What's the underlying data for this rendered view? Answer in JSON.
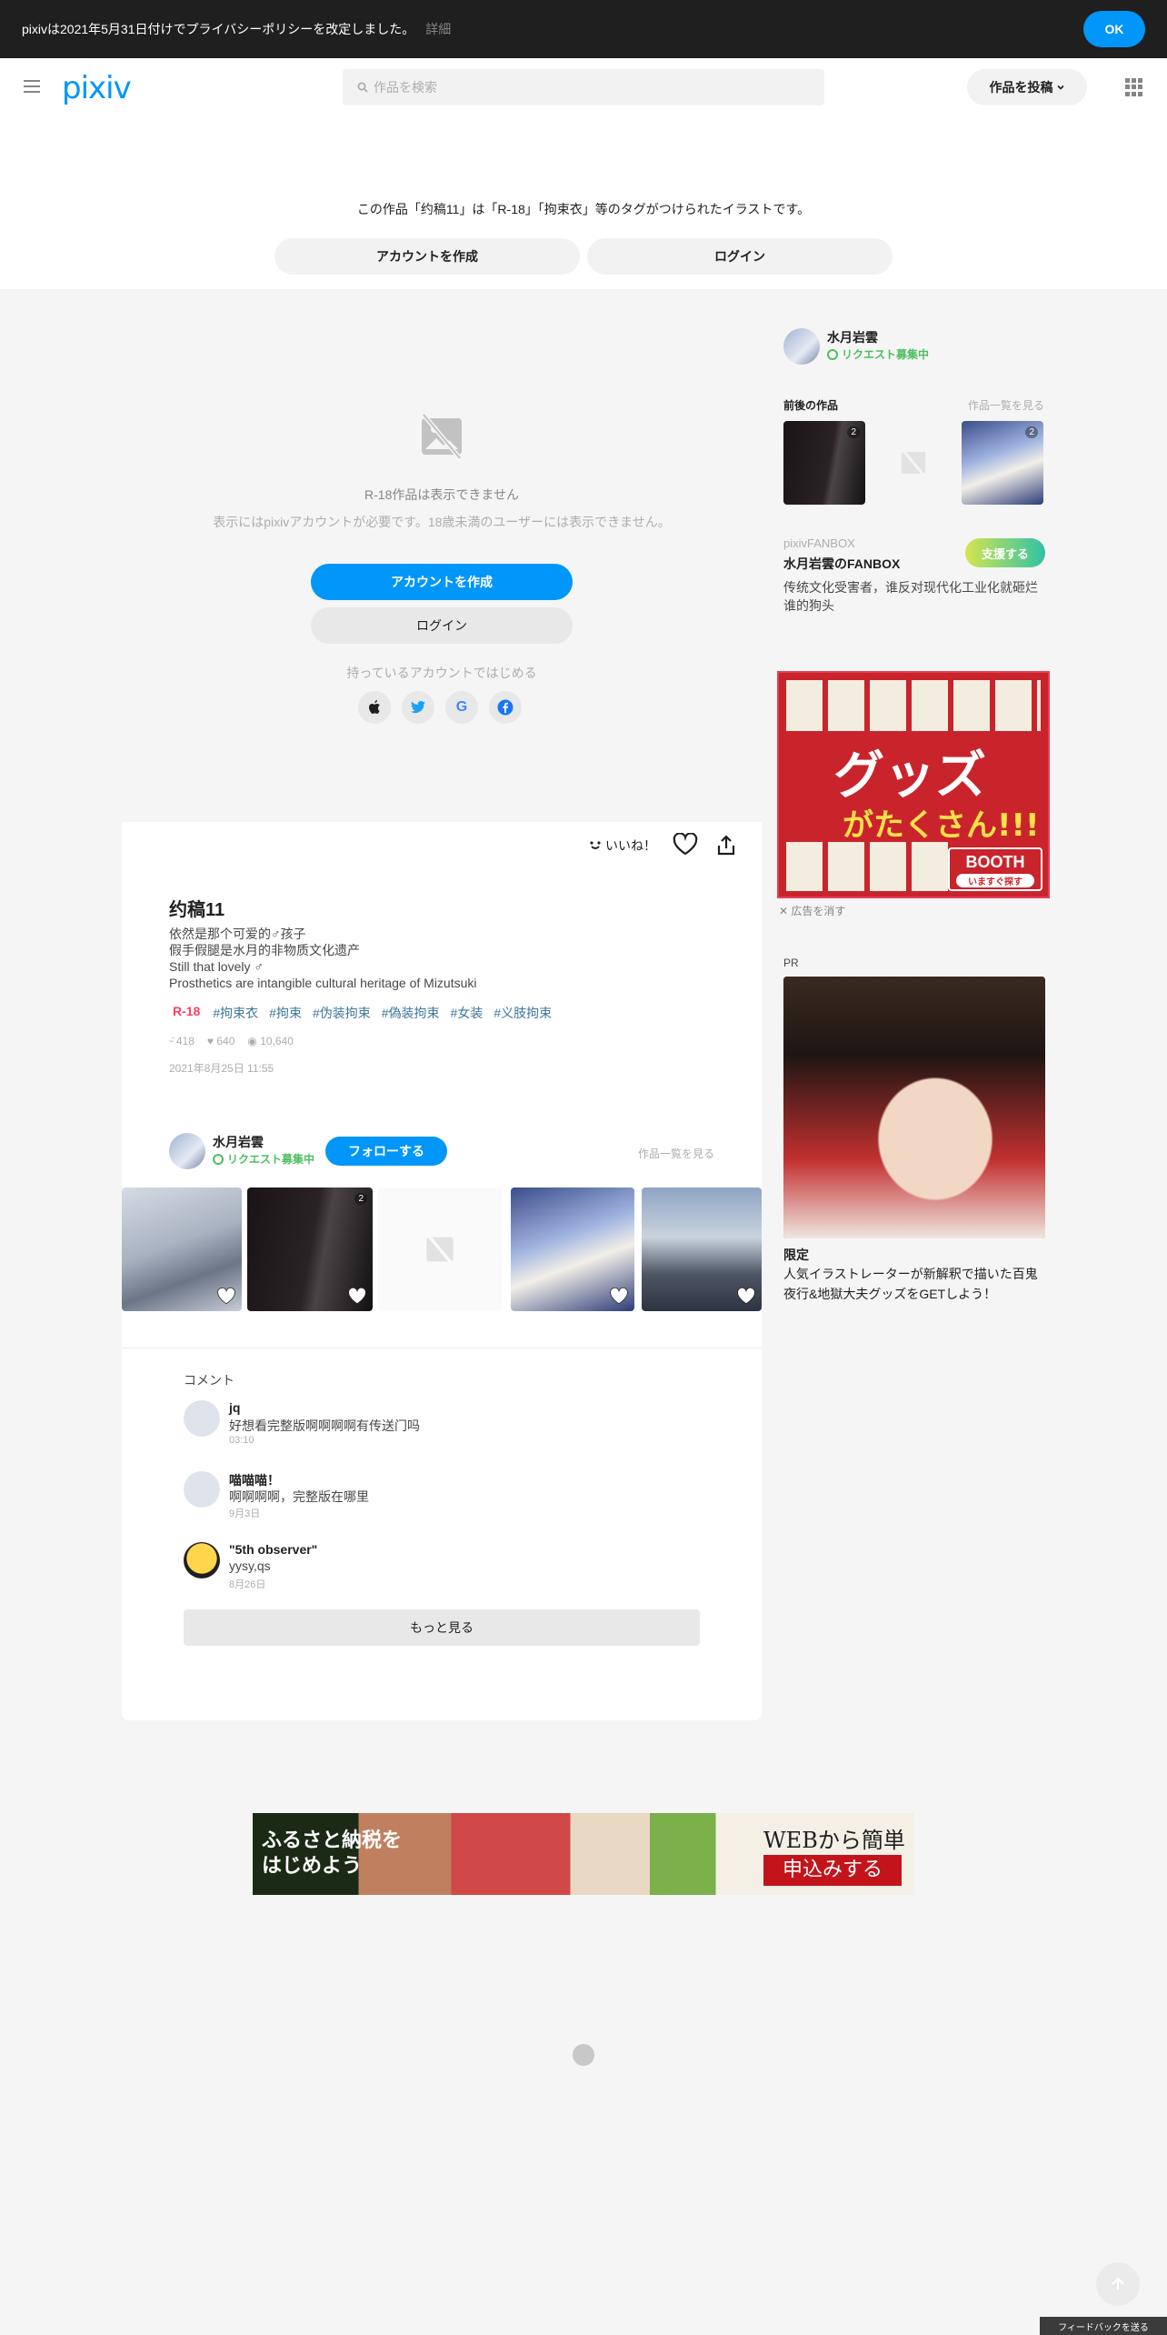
{
  "notice": {
    "text": "pixivは2021年5月31日付けでプライバシーポリシーを改定しました。",
    "detail": "詳細",
    "ok": "OK"
  },
  "header": {
    "logo": "pixiv",
    "search_placeholder": "作品を検索",
    "post_label": "作品を投稿"
  },
  "top": {
    "tagline": "この作品「约稿11」は「R-18」「拘束衣」等のタグがつけられたイラストです。",
    "create_account": "アカウントを作成",
    "login": "ログイン"
  },
  "restricted": {
    "title": "R-18作品は表示できません",
    "subtitle": "表示にはpixivアカウントが必要です。18歳未満のユーザーには表示できません。",
    "create_account": "アカウントを作成",
    "login": "ログイン",
    "existing": "持っているアカウントではじめる",
    "social": [
      "apple-icon",
      "twitter-icon",
      "google-icon",
      "facebook-icon"
    ]
  },
  "artwork": {
    "iine": "いいね！",
    "title": "约稿11",
    "description": [
      "依然是那个可爱的♂孩子",
      "假手假腿是水月的非物质文化遗产",
      "Still that lovely ♂",
      "Prosthetics are intangible cultural heritage of Mizutsuki"
    ],
    "r18": "R-18",
    "tags": [
      "#拘束衣",
      "#拘束",
      "#伪装拘束",
      "#偽装拘束",
      "#女装",
      "#义肢拘束"
    ],
    "likes": "418",
    "bookmarks": "640",
    "views": "10,640",
    "date": "2021年8月25日 11:55"
  },
  "author": {
    "name": "水月岩雲",
    "request": "リクエスト募集中",
    "follow": "フォローする",
    "work_list": "作品一覧を見る",
    "badge_count": "2"
  },
  "comments": {
    "heading": "コメント",
    "items": [
      {
        "name": "jq",
        "text": "好想看完整版啊啊啊啊有传送门吗",
        "time": "03:10"
      },
      {
        "name": "喵喵喵！",
        "text": "啊啊啊啊，完整版在哪里",
        "time": "9月3日"
      },
      {
        "name": "\"5th observer\"",
        "text": "yysy,qs",
        "time": "8月26日"
      }
    ],
    "more": "もっと見る"
  },
  "sidebar": {
    "name": "水月岩雲",
    "request": "リクエスト募集中",
    "adjacent": "前後の作品",
    "work_list": "作品一覧を見る",
    "thumb_badge": "2",
    "fanbox_label": "pixivFANBOX",
    "fanbox_title": "水月岩雲のFANBOX",
    "fanbox_desc": "传统文化受害者，谁反对现代化工业化就砸烂谁的狗头",
    "support": "支援する",
    "hide_ad": "広告を消す",
    "pr": "PR",
    "pr_title": "限定",
    "pr_desc": "人気イラストレーターが新解釈で描いた百鬼夜行&地獄大夫グッズをGETしよう！"
  },
  "booth_ad": {
    "headline": "グッズ",
    "sub": "がたくさん!!!",
    "brand": "BOOTH",
    "cta": "いますぐ探す"
  },
  "furusato_ad": {
    "left": "ふるさと納税を\nはじめよう",
    "right_top": "WEBから簡単",
    "right_bottom": "申込みする"
  },
  "feedback": "フィードバックを送る",
  "colors": {
    "accent": "#0096fa",
    "r18": "#ff4060",
    "request": "#4dbf60",
    "tag": "#3d7699"
  }
}
